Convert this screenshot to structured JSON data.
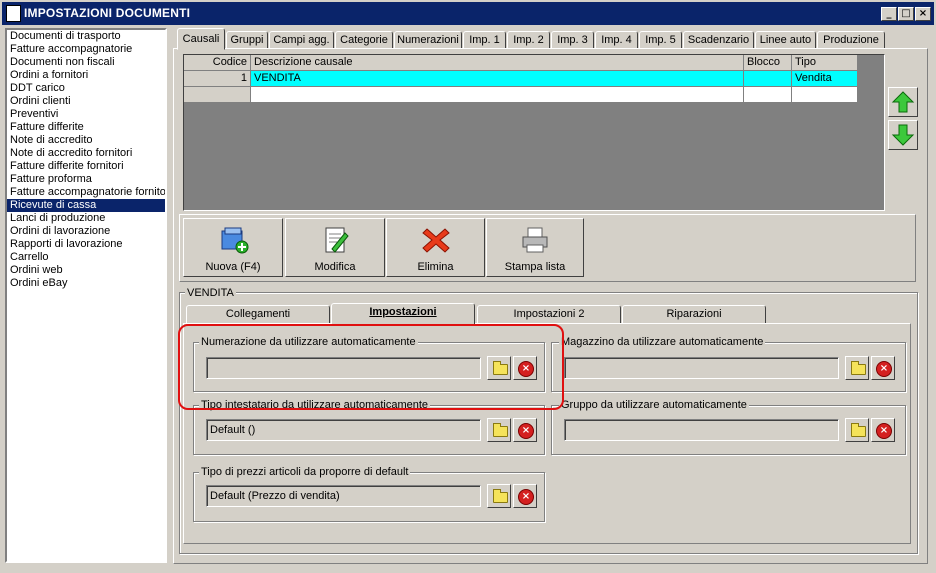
{
  "window": {
    "title": "IMPOSTAZIONI DOCUMENTI",
    "min_label": "_",
    "max_label": "□",
    "close_label": "×"
  },
  "sidebar": {
    "items": [
      "Documenti di trasporto",
      "Fatture accompagnatorie",
      "Documenti non fiscali",
      "Ordini a fornitori",
      "DDT carico",
      "Ordini clienti",
      "Preventivi",
      "Fatture differite",
      "Note di accredito",
      "Note di accredito fornitori",
      "Fatture differite fornitori",
      "Fatture proforma",
      "Fatture accompagnatorie fornitori",
      "Ricevute di cassa",
      "Lanci di produzione",
      "Ordini di lavorazione",
      "Rapporti di lavorazione",
      "Carrello",
      "Ordini web",
      "Ordini eBay"
    ],
    "selected_index": 13
  },
  "tabs": [
    "Causali",
    "Gruppi",
    "Campi agg.",
    "Categorie",
    "Numerazioni",
    "Imp. 1",
    "Imp. 2",
    "Imp. 3",
    "Imp. 4",
    "Imp. 5",
    "Scadenzario",
    "Linee auto",
    "Produzione"
  ],
  "active_tab": 0,
  "grid": {
    "columns": [
      "Codice",
      "Descrizione causale",
      "Blocco",
      "Tipo"
    ],
    "rows": [
      {
        "codice": "1",
        "descrizione": "VENDITA",
        "blocco": "",
        "tipo": "Vendita"
      },
      {
        "codice": "",
        "descrizione": "",
        "blocco": "",
        "tipo": ""
      }
    ],
    "selection_color": "#00ffff"
  },
  "toolbar": {
    "new_label": "Nuova (F4)",
    "edit_label": "Modifica",
    "delete_label": "Elimina",
    "print_label": "Stampa lista"
  },
  "detail": {
    "group_title": "VENDITA",
    "subtabs": [
      "Collegamenti",
      "Impostazioni",
      "Impostazioni 2",
      "Riparazioni"
    ],
    "active_subtab": 1,
    "fields": {
      "numerazione": {
        "label": "Numerazione da utilizzare automaticamente",
        "value": ""
      },
      "magazzino": {
        "label": "Magazzino da utilizzare automaticamente",
        "value": ""
      },
      "intestatario": {
        "label": "Tipo intestatario da utilizzare automaticamente",
        "value": "Default ()"
      },
      "gruppo": {
        "label": "Gruppo da utilizzare automaticamente",
        "value": ""
      },
      "prezzi": {
        "label": "Tipo di prezzi articoli da proporre di default",
        "value": "Default (Prezzo di vendita)"
      }
    }
  },
  "colors": {
    "titlebar": "#0a246a",
    "highlight_box": "#e01010",
    "window_bg": "#d4d0c8"
  }
}
